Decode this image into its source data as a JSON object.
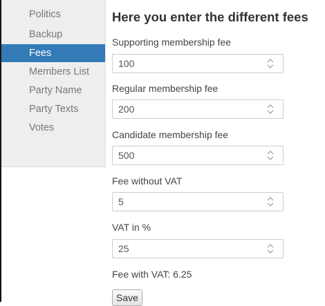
{
  "sidebar": {
    "items": [
      {
        "label": "Politics",
        "active": false
      },
      {
        "label": "Backup",
        "active": false
      },
      {
        "label": "Fees",
        "active": true
      },
      {
        "label": "Members List",
        "active": false
      },
      {
        "label": "Party Name",
        "active": false
      },
      {
        "label": "Party Texts",
        "active": false
      },
      {
        "label": "Votes",
        "active": false
      }
    ]
  },
  "main": {
    "title": "Here you enter the different fees",
    "fields": [
      {
        "label": "Supporting membership fee",
        "value": "100"
      },
      {
        "label": "Regular membership fee",
        "value": "200"
      },
      {
        "label": "Candidate membership fee",
        "value": "500"
      },
      {
        "label": "Fee without VAT",
        "value": "5"
      },
      {
        "label": "VAT in %",
        "value": "25"
      }
    ],
    "result_text": "Fee with VAT: 6.25",
    "save_label": "Save"
  },
  "colors": {
    "accent": "#337ab7",
    "sidebar_bg": "#eeeeee"
  },
  "icons": {
    "spinner": "up-down-spinner-icon"
  }
}
